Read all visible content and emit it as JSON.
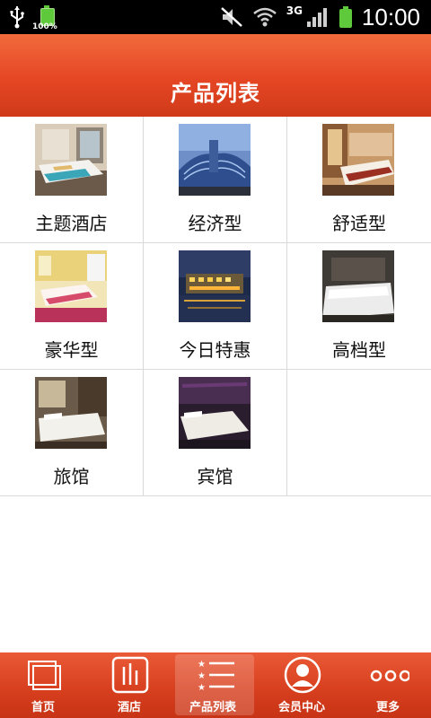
{
  "status_bar": {
    "battery_percent": "100%",
    "network": "3G",
    "time": "10:00"
  },
  "header": {
    "title": "产品列表"
  },
  "products": [
    {
      "label": "主题酒店",
      "image": "themed-hotel-room-photo"
    },
    {
      "label": "经济型",
      "image": "modern-hotel-building-photo"
    },
    {
      "label": "舒适型",
      "image": "comfort-hotel-room-photo"
    },
    {
      "label": "豪华型",
      "image": "luxury-hotel-room-photo"
    },
    {
      "label": "今日特惠",
      "image": "hotel-night-exterior-photo"
    },
    {
      "label": "高档型",
      "image": "premium-bed-photo"
    },
    {
      "label": "旅馆",
      "image": "inn-bedroom-photo"
    },
    {
      "label": "宾馆",
      "image": "guesthouse-bedroom-photo"
    }
  ],
  "bottom_nav": {
    "items": [
      {
        "label": "首页",
        "icon": "home-icon"
      },
      {
        "label": "酒店",
        "icon": "hotel-icon"
      },
      {
        "label": "产品列表",
        "icon": "product-list-icon"
      },
      {
        "label": "会员中心",
        "icon": "member-center-icon"
      },
      {
        "label": "更多",
        "icon": "more-icon"
      }
    ],
    "active_index": 2
  },
  "colors": {
    "header_red": "#e54624",
    "nav_red": "#d8401f",
    "status_bg": "#000000"
  }
}
